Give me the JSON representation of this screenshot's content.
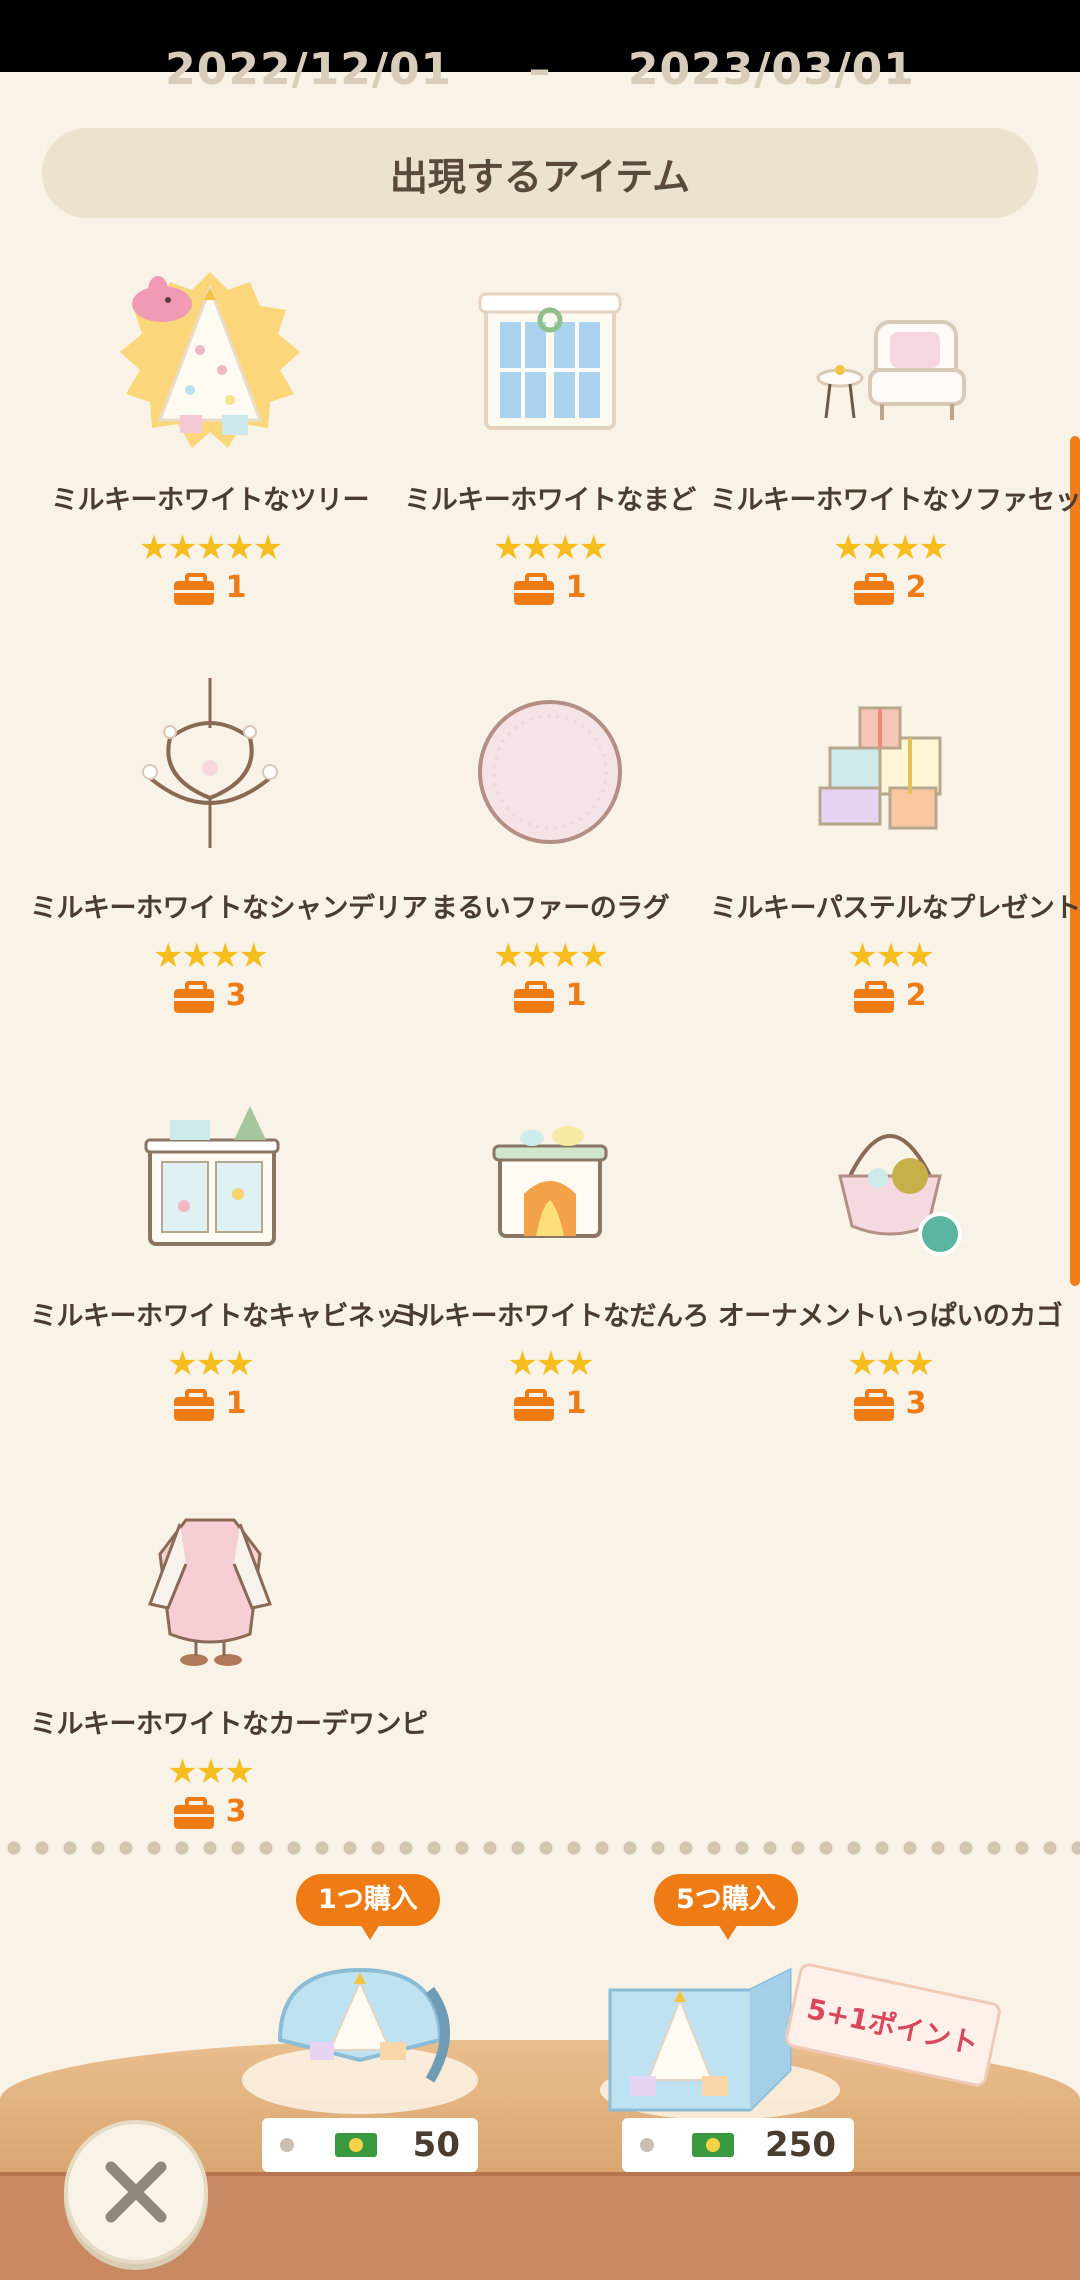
{
  "header": {
    "date_start": "2022/12/01",
    "date_end": "2023/03/01",
    "section_title": "出現するアイテム"
  },
  "items": [
    {
      "name": "ミルキーホワイトなツリー",
      "stars": "★★★★★",
      "qty": "1",
      "icon": "christmas-tree-icon"
    },
    {
      "name": "ミルキーホワイトなまど",
      "stars": "★★★★",
      "qty": "1",
      "icon": "window-icon"
    },
    {
      "name": "ミルキーホワイトなソファセット",
      "stars": "★★★★",
      "qty": "2",
      "icon": "sofa-set-icon"
    },
    {
      "name": "ミルキーホワイトなシャンデリア",
      "stars": "★★★★",
      "qty": "3",
      "icon": "chandelier-icon"
    },
    {
      "name": "まるいファーのラグ",
      "stars": "★★★★",
      "qty": "1",
      "icon": "round-rug-icon"
    },
    {
      "name": "ミルキーパステルなプレゼント",
      "stars": "★★★",
      "qty": "2",
      "icon": "presents-icon"
    },
    {
      "name": "ミルキーホワイトなキャビネット",
      "stars": "★★★",
      "qty": "1",
      "icon": "cabinet-icon"
    },
    {
      "name": "ミルキーホワイトなだんろ",
      "stars": "★★★",
      "qty": "1",
      "icon": "fireplace-icon"
    },
    {
      "name": "オーナメントいっぱいのカゴ",
      "stars": "★★★",
      "qty": "3",
      "icon": "ornament-basket-icon"
    },
    {
      "name": "ミルキーホワイトなカーデワンピ",
      "stars": "★★★",
      "qty": "3",
      "icon": "cardigan-dress-icon"
    }
  ],
  "purchase": {
    "one": {
      "label": "1つ購入",
      "price": "50"
    },
    "five": {
      "label": "5つ購入",
      "price": "250",
      "bonus_tag": "5+1ポイント"
    }
  },
  "colors": {
    "accent": "#ee7b14",
    "star": "#f6bd1e",
    "background": "#f8f3e6"
  }
}
